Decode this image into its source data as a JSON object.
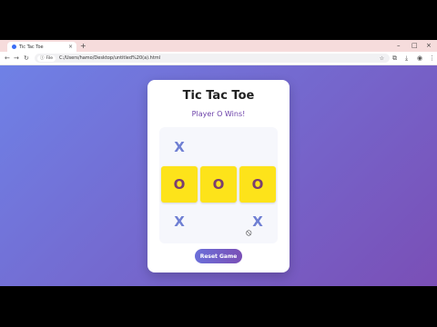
{
  "browser": {
    "tab_title": "Tic Tac Toe",
    "tab_close": "×",
    "new_tab": "+",
    "window_controls": [
      "–",
      "□",
      "×"
    ],
    "nav": {
      "back": "←",
      "forward": "→",
      "reload": "↻"
    },
    "address": {
      "chip_label": "File",
      "chip_icon": "ⓘ",
      "url": "C:/Users/hamo/Desktop/untitled%20(a).html"
    },
    "star": "☆",
    "toolbar_icons": [
      "⧉",
      "⤓",
      "◉",
      "⋮"
    ]
  },
  "game": {
    "title": "Tic Tac Toe",
    "status": "Player O Wins!",
    "board": [
      "X",
      "",
      "",
      "O",
      "O",
      "O",
      "X",
      "",
      "X"
    ],
    "winning_line": [
      3,
      4,
      5
    ],
    "cursor": "⦸",
    "reset_label": "Reset Game"
  }
}
